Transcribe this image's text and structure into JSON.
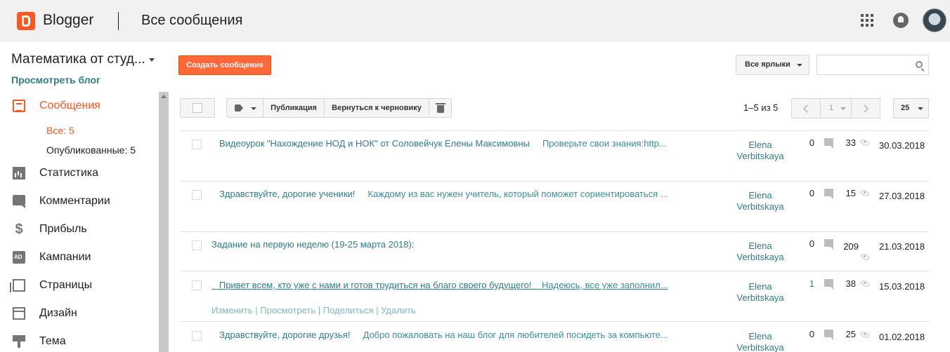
{
  "header": {
    "brand": "Blogger",
    "title": "Все сообщения"
  },
  "sidebar": {
    "blog_name": "Математика от студ...",
    "view_blog": "Просмотреть блог",
    "nav": [
      {
        "label": "Сообщения",
        "icon": "posts-icon",
        "active": true
      },
      {
        "label": "Статистика",
        "icon": "stats-icon"
      },
      {
        "label": "Комментарии",
        "icon": "comments-icon"
      },
      {
        "label": "Прибыль",
        "icon": "earnings-icon"
      },
      {
        "label": "Кампании",
        "icon": "campaigns-icon"
      },
      {
        "label": "Страницы",
        "icon": "pages-icon"
      },
      {
        "label": "Дизайн",
        "icon": "layout-icon"
      },
      {
        "label": "Тема",
        "icon": "theme-icon"
      }
    ],
    "sub": [
      {
        "label": "Все: 5",
        "active": true
      },
      {
        "label": "Опубликованные: 5"
      }
    ],
    "earn_glyph": "$"
  },
  "toolbar": {
    "create": "Создать сообщение",
    "labels_filter": "Все ярлыки",
    "search_placeholder": "",
    "publish": "Публикация",
    "revert": "Вернуться к черновику",
    "range": "1–5 из 5",
    "page": "1",
    "per_page": "25"
  },
  "posts": [
    {
      "title": "Видеоурок \"Нахождение НОД и НОК\" от Соловейчук Елены Максимовны",
      "snippet": "Проверьте свои знания:http...",
      "author_first": "Elena",
      "author_last": "Verbitskaya",
      "comments": "0",
      "views": "33",
      "date": "30.03.2018"
    },
    {
      "title": "Здравствуйте, дорогие ученики!",
      "snippet": "Каждому из вас нужен учитель, который поможет сориентироваться ...",
      "author_first": "Elena",
      "author_last": "Verbitskaya",
      "comments": "0",
      "views": "15",
      "date": "27.03.2018"
    },
    {
      "title": "Задание на первую неделю (19-25 марта 2018):",
      "snippet": "",
      "author_first": "Elena",
      "author_last": "Verbitskaya",
      "comments": "0",
      "views": "209",
      "date": "21.03.2018"
    },
    {
      "title": "Привет всем, кто уже с нами и готов трудиться на благо своего будущего!",
      "snippet": "Надеюсь, все уже заполнил...",
      "author_first": "Elena",
      "author_last": "Verbitskaya",
      "comments": "1",
      "views": "38",
      "date": "15.03.2018",
      "actions": [
        "Изменить",
        "Просмотреть",
        "Поделиться",
        "Удалить"
      ],
      "action_sep": " | "
    },
    {
      "title": "Здравствуйте, дорогие друзья!",
      "snippet": "Добро пожаловать на наш блог для любителей посидеть за компьюте...",
      "author_first": "Elena",
      "author_last": "Verbitskaya",
      "comments": "0",
      "views": "25",
      "date": "01.02.2018"
    }
  ]
}
